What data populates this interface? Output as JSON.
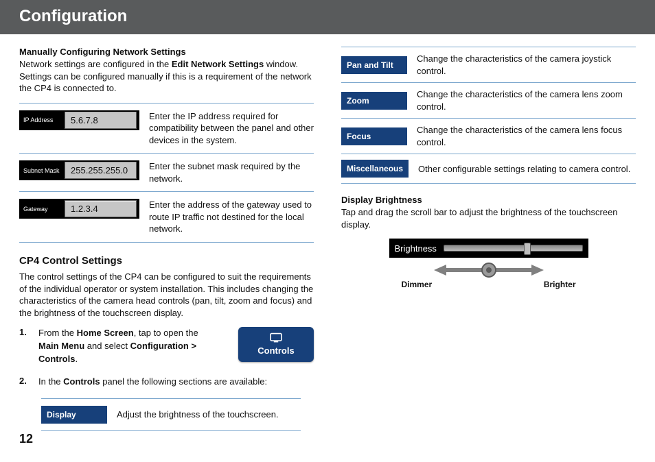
{
  "banner_title": "Configuration",
  "page_number": "12",
  "left": {
    "manual_heading": "Manually Configuring Network Settings",
    "manual_para_a": "Network settings are configured in the ",
    "manual_para_bold": "Edit Network Settings",
    "manual_para_b": " window. Settings can be configured manually if this is a requirement of the network the CP4 is connected to.",
    "net": [
      {
        "label": "IP Address",
        "value": "5.6.7.8",
        "desc": "Enter the IP address required for compatibility between the panel and other devices in the system."
      },
      {
        "label": "Subnet Mask",
        "value": "255.255.255.0",
        "desc": "Enter the subnet mask required by the network."
      },
      {
        "label": "Gateway",
        "value": "1.2.3.4",
        "desc": "Enter the address of the gateway used to route IP traffic not destined for the local network."
      }
    ],
    "cp4_heading": "CP4 Control Settings",
    "cp4_para": "The control settings of the CP4 can be configured to suit the requirements of the individual operator or system installation. This includes changing the characteristics of the camera head controls (pan, tilt, zoom and focus) and the brightness of the touchscreen display.",
    "step1_a": "From the ",
    "step1_b1": "Home Screen",
    "step1_b": ", tap to open the ",
    "step1_b2": "Main Menu",
    "step1_c": " and select ",
    "step1_b3": "Configuration > Controls",
    "step1_d": ".",
    "controls_btn": "Controls",
    "step2_a": "In the ",
    "step2_b": "Controls",
    "step2_c": " panel the following sections are available:",
    "display_tag": "Display",
    "display_desc": "Adjust the brightness of the touchscreen."
  },
  "right": {
    "rows": [
      {
        "tag": "Pan and Tilt",
        "desc": "Change the characteristics of the camera joystick control."
      },
      {
        "tag": "Zoom",
        "desc": "Change the characteristics of the camera lens zoom control."
      },
      {
        "tag": "Focus",
        "desc": "Change the characteristics of the camera lens focus control."
      },
      {
        "tag": "Miscellaneous",
        "desc": "Other configurable settings relating to camera control."
      }
    ],
    "bright_heading": "Display Brightness",
    "bright_para": "Tap and drag the scroll bar to adjust the brightness of the touchscreen display.",
    "bright_label": "Brightness",
    "dimmer": "Dimmer",
    "brighter": "Brighter"
  }
}
